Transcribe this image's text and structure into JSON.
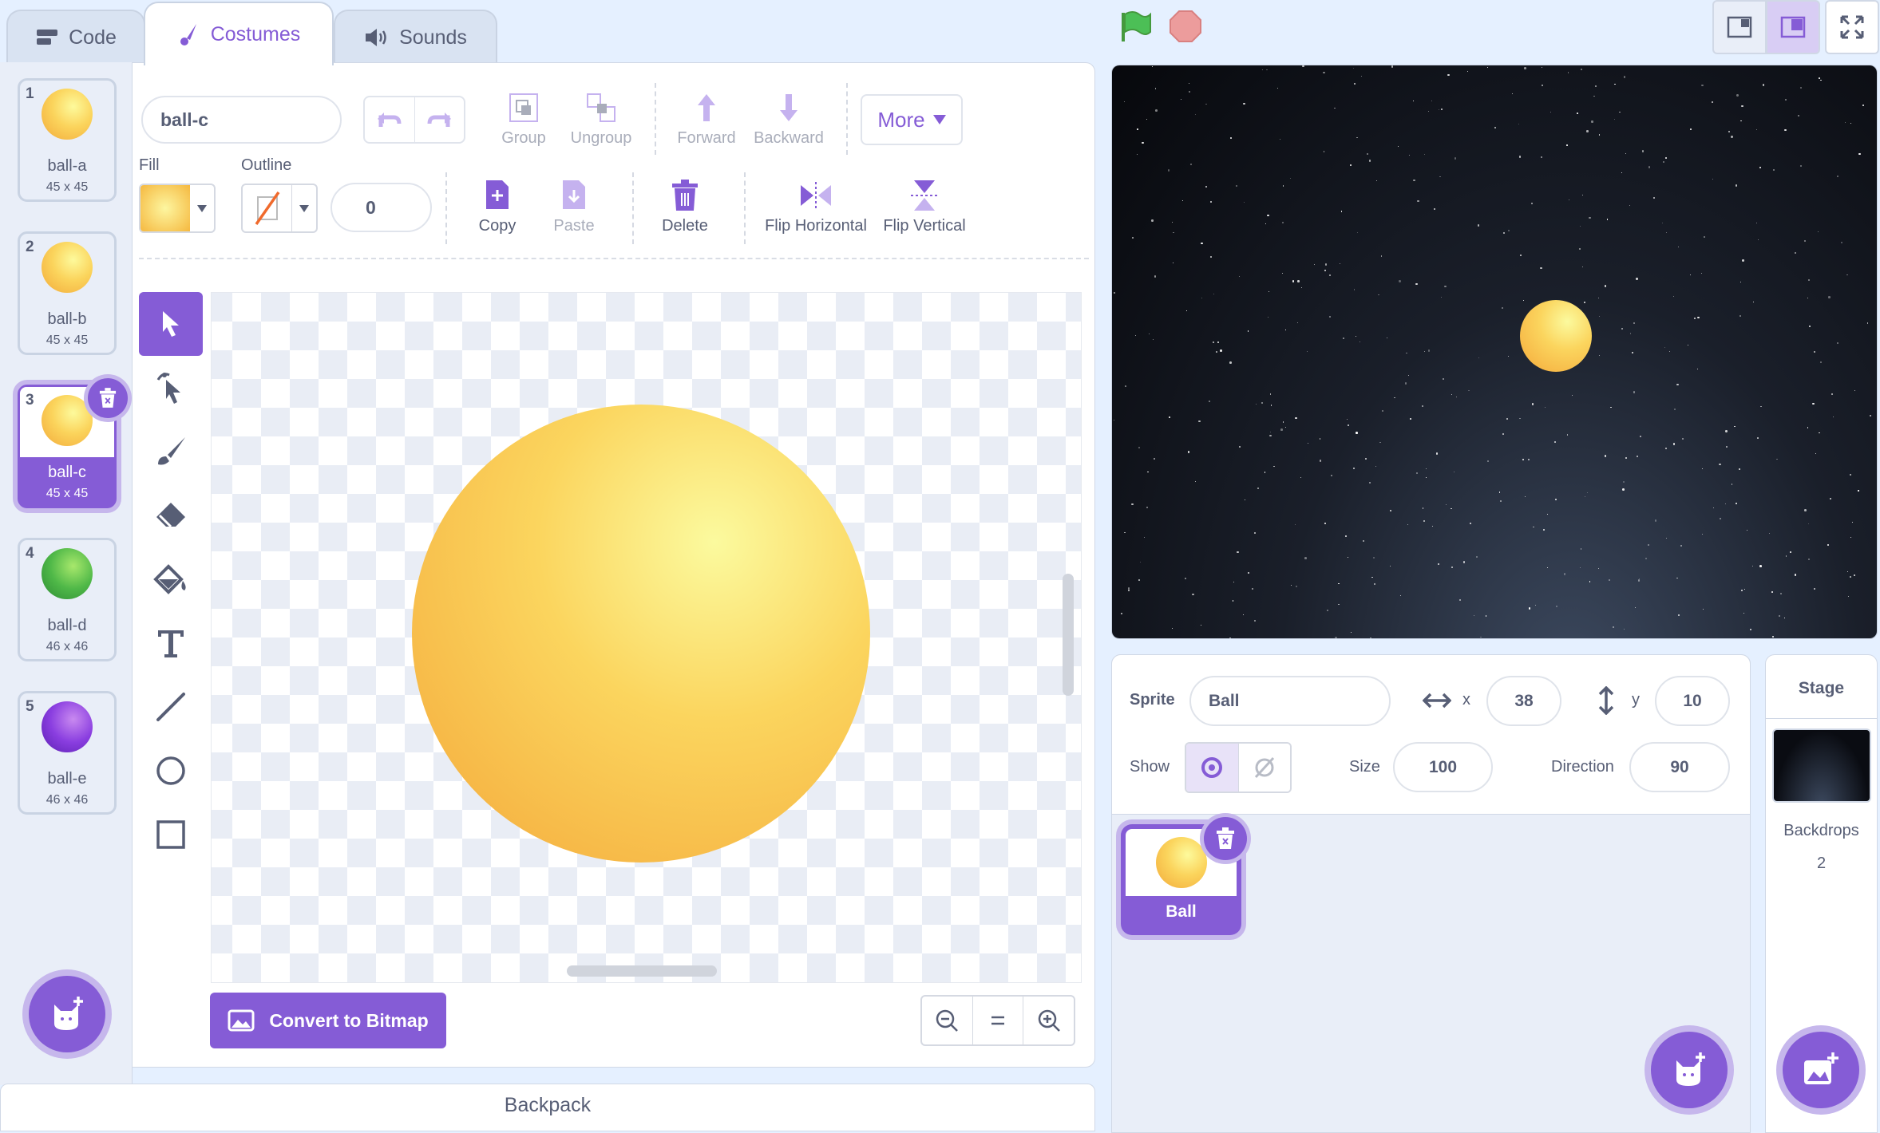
{
  "tabs": [
    {
      "label": "Code",
      "icon": "code-blocks-icon"
    },
    {
      "label": "Costumes",
      "icon": "brush-icon"
    },
    {
      "label": "Sounds",
      "icon": "speaker-icon"
    }
  ],
  "costumes": [
    {
      "num": "1",
      "name": "ball-a",
      "size": "45 x 45",
      "color": "yellow"
    },
    {
      "num": "2",
      "name": "ball-b",
      "size": "45 x 45",
      "color": "yellow"
    },
    {
      "num": "3",
      "name": "ball-c",
      "size": "45 x 45",
      "color": "yellow",
      "selected": true
    },
    {
      "num": "4",
      "name": "ball-d",
      "size": "46 x 46",
      "color": "green"
    },
    {
      "num": "5",
      "name": "ball-e",
      "size": "46 x 46",
      "color": "purple"
    }
  ],
  "editor": {
    "costume_name": "ball-c",
    "group": "Group",
    "ungroup": "Ungroup",
    "forward": "Forward",
    "backward": "Backward",
    "more": "More",
    "fill_label": "Fill",
    "outline_label": "Outline",
    "outline_width": "0",
    "copy": "Copy",
    "paste": "Paste",
    "delete": "Delete",
    "flip_h": "Flip Horizontal",
    "flip_v": "Flip Vertical",
    "convert": "Convert to Bitmap",
    "fill_color": "#fbc54a"
  },
  "backpack": "Backpack",
  "sprite_info": {
    "sprite_label": "Sprite",
    "sprite_name": "Ball",
    "x_label": "x",
    "x": "38",
    "y_label": "y",
    "y": "10",
    "show_label": "Show",
    "size_label": "Size",
    "size": "100",
    "direction_label": "Direction",
    "direction": "90"
  },
  "sprites": [
    {
      "name": "Ball"
    }
  ],
  "stage_panel": {
    "title": "Stage",
    "backdrops_label": "Backdrops",
    "backdrops_count": "2"
  },
  "colors": {
    "accent": "#855cd6",
    "text": "#575e75"
  }
}
